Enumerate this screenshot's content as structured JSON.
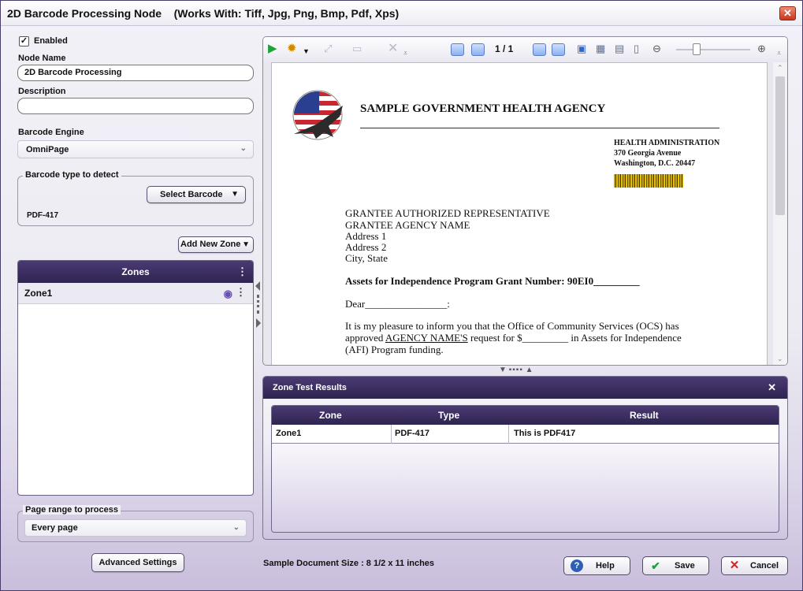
{
  "window": {
    "title": "2D Barcode Processing Node",
    "works_with": "(Works With: Tiff, Jpg, Png, Bmp, Pdf, Xps)",
    "close_glyph": "✕"
  },
  "left": {
    "enabled_label": "Enabled",
    "enabled_checked": true,
    "node_name_label": "Node Name",
    "node_name_value": "2D Barcode Processing",
    "description_label": "Description",
    "description_value": "",
    "barcode_engine_label": "Barcode Engine",
    "barcode_engine_value": "OmniPage",
    "barcode_type_legend": "Barcode type to detect",
    "select_barcode_label": "Select Barcode",
    "barcode_type_value": "PDF-417",
    "add_new_zone_label": "Add New Zone",
    "zones_title": "Zones",
    "zones": [
      {
        "name": "Zone1"
      }
    ],
    "page_range_legend": "Page range to process",
    "page_range_value": "Every page",
    "advanced_settings_label": "Advanced Settings"
  },
  "viewer": {
    "page_indicator": "1 / 1",
    "zoom_fraction": 0.25
  },
  "document": {
    "agency": "SAMPLE GOVERNMENT HEALTH AGENCY",
    "health_admin": "HEALTH ADMINISTRATION",
    "street": "370 Georgia Avenue",
    "city": "Washington, D.C. 20447",
    "addressee": [
      "GRANTEE AUTHORIZED REPRESENTATIVE",
      "GRANTEE AGENCY NAME",
      "Address 1",
      "Address 2",
      "City, State"
    ],
    "grant_line": "Assets for Independence Program Grant Number:  90EI0_________",
    "dear": "Dear________________:",
    "para1": "It is my pleasure to inform you that the Office of Community Services (OCS) has",
    "para2_pre": "approved ",
    "para2_link": "AGENCY NAME'S",
    "para2_post": "  request for $_________ in Assets for Independence",
    "para3": "(AFI) Program funding."
  },
  "results": {
    "title": "Zone Test Results",
    "close_glyph": "✕",
    "columns": [
      "Zone",
      "Type",
      "Result"
    ],
    "rows": [
      {
        "zone": "Zone1",
        "type": "PDF-417",
        "result": "This is PDF417"
      }
    ]
  },
  "footer": {
    "sample_size": "Sample Document Size : 8 1/2 x 11 inches",
    "help_label": "Help",
    "save_label": "Save",
    "cancel_label": "Cancel"
  },
  "colors": {
    "header_purple": "#3a2d5e",
    "accent_green": "#1ea23a",
    "cancel_red": "#d32222"
  }
}
